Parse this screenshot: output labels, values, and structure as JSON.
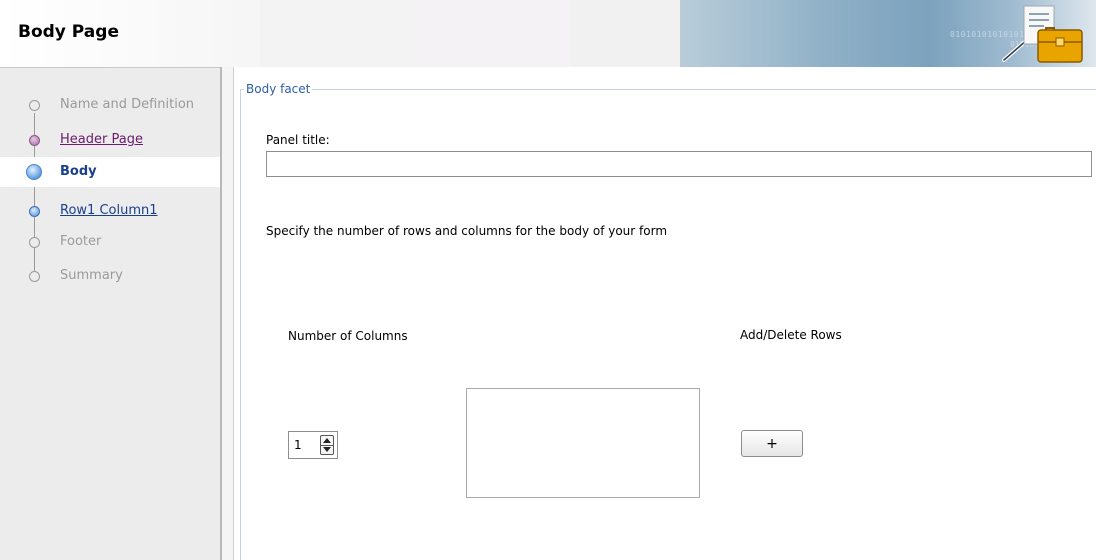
{
  "header": {
    "title": "Body Page",
    "logo_icon": "briefcase-document-icon",
    "banner_binary_1": "0101010101010101010101",
    "banner_binary_2": "01010101010"
  },
  "train": {
    "steps": [
      {
        "label": "Name and Definition",
        "state": "disabled"
      },
      {
        "label": "Header Page",
        "state": "visited"
      },
      {
        "label": "Body",
        "state": "active"
      },
      {
        "label": "Row1 Column1",
        "state": "next"
      },
      {
        "label": "Footer",
        "state": "disabled"
      },
      {
        "label": "Summary",
        "state": "disabled"
      }
    ]
  },
  "form": {
    "legend": "Body facet",
    "panel_title_label": "Panel title:",
    "panel_title_value": "",
    "instructions": "Specify the number of rows and columns for the body of your form",
    "columns_label": "Number of Columns",
    "columns_value": "1",
    "rows_label": "Add/Delete Rows",
    "add_row_label": "+"
  },
  "colors": {
    "active_step": "#1a3f8c",
    "visited_step": "#6a1b6a",
    "disabled_step": "#9a9a9a",
    "legend": "#2f5fa8"
  }
}
